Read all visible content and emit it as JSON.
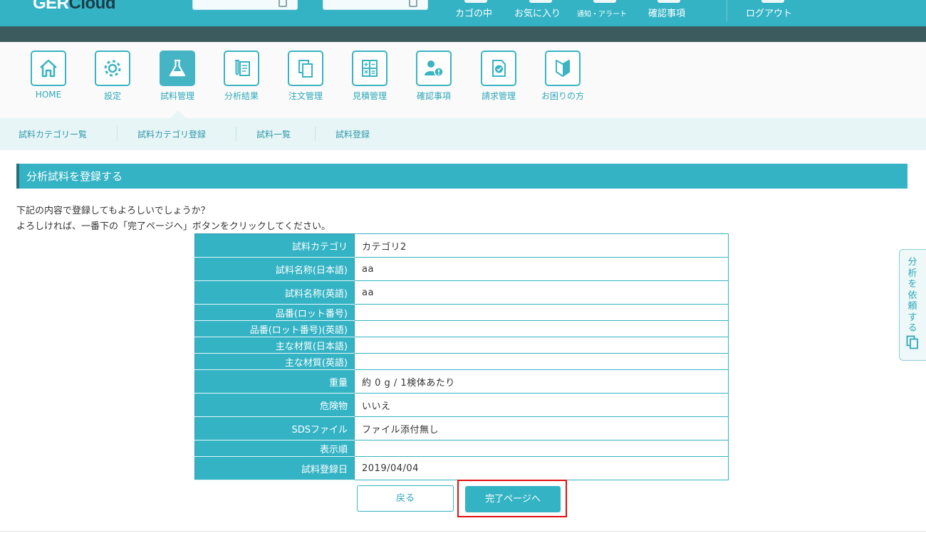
{
  "header": {
    "logo_main": "GER",
    "logo_sub": "Cloud",
    "links": [
      {
        "label": "カゴの中"
      },
      {
        "label": "お気に入り"
      },
      {
        "label": "通知・アラート"
      },
      {
        "label": "確認事項"
      },
      {
        "label": "ログアウト"
      }
    ]
  },
  "icon_nav": {
    "items": [
      {
        "label": "HOME",
        "icon": "home-icon"
      },
      {
        "label": "設定",
        "icon": "gear-icon"
      },
      {
        "label": "試料管理",
        "icon": "flask-icon"
      },
      {
        "label": "分析結果",
        "icon": "test-tube-document-icon"
      },
      {
        "label": "注文管理",
        "icon": "copy-documents-icon"
      },
      {
        "label": "見積管理",
        "icon": "calculator-icon"
      },
      {
        "label": "確認事項",
        "icon": "user-alert-icon"
      },
      {
        "label": "請求管理",
        "icon": "check-document-icon"
      },
      {
        "label": "お困りの方",
        "icon": "beginner-mark-icon"
      }
    ],
    "active_index": 2
  },
  "sub_nav": {
    "items": [
      {
        "label": "試料カテゴリー覧"
      },
      {
        "label": "試料カテゴリ登録"
      },
      {
        "label": "試料一覧"
      },
      {
        "label": "試料登録"
      }
    ]
  },
  "page": {
    "title": "分析試料を登録する",
    "intro_line1": "下記の内容で登録してもよろしいでしょうか？",
    "intro_line2": "よろしければ、一番下の「完了ページへ」ボタンをクリックしてください。"
  },
  "confirm_table": {
    "rows": [
      {
        "label": "試料カテゴリ",
        "value": "カテゴリ2"
      },
      {
        "label": "試料名称(日本語)",
        "value": "aa"
      },
      {
        "label": "試料名称(英語)",
        "value": "aa"
      },
      {
        "label": "品番(ロット番号)",
        "value": ""
      },
      {
        "label": "品番(ロット番号)(英語)",
        "value": ""
      },
      {
        "label": "主な材質(日本語)",
        "value": ""
      },
      {
        "label": "主な材質(英語)",
        "value": ""
      },
      {
        "label": "重量",
        "value": "約 0 g / 1検体あたり"
      },
      {
        "label": "危険物",
        "value": "いいえ"
      },
      {
        "label": "SDSファイル",
        "value": "ファイル添付無し"
      },
      {
        "label": "表示順",
        "value": ""
      },
      {
        "label": "試料登録日",
        "value": "2019/04/04"
      }
    ]
  },
  "buttons": {
    "back_label": "戻る",
    "complete_label": "完了ページへ"
  },
  "side_tab": {
    "label": "分析を依頼する",
    "icon": "document-icon"
  },
  "colors": {
    "accent": "#34b3c5",
    "dark_bar": "#3c5b5e",
    "highlight": "#e01010"
  }
}
